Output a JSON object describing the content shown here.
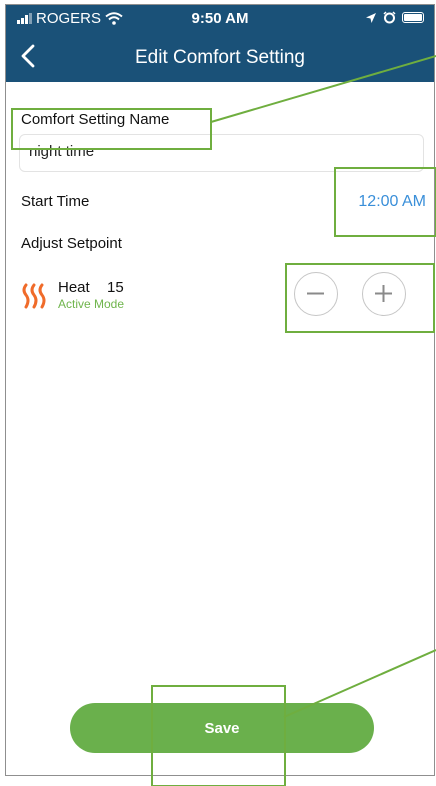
{
  "status_bar": {
    "carrier": "ROGERS",
    "time": "9:50 AM"
  },
  "nav": {
    "title": "Edit Comfort Setting"
  },
  "form": {
    "name_label": "Comfort Setting Name",
    "name_value": "night time",
    "start_time_label": "Start Time",
    "start_time_value": "12:00 AM",
    "adjust_label": "Adjust Setpoint"
  },
  "setpoint": {
    "mode_name": "Heat",
    "value": "15",
    "status": "Active Mode"
  },
  "actions": {
    "save_label": "Save"
  },
  "colors": {
    "header": "#1a5178",
    "accent_blue": "#3a8fd9",
    "accent_green": "#6ab04c",
    "heat_orange": "#f06b2a",
    "annotation": "#6fae3f"
  },
  "icons": {
    "back": "chevron-left-icon",
    "heat": "heat-waves-icon",
    "decrease": "minus-icon",
    "increase": "plus-icon"
  }
}
